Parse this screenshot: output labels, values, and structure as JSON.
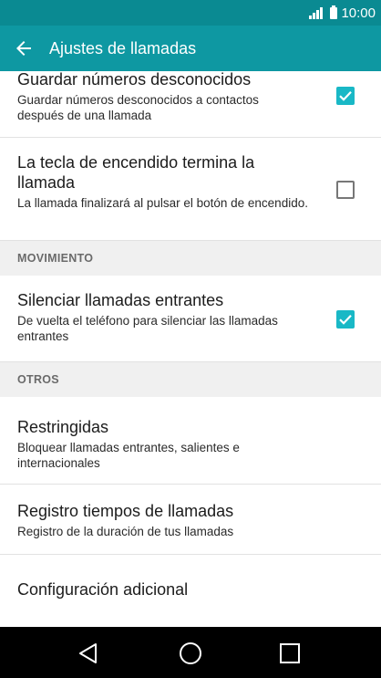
{
  "status_bar": {
    "time": "10:00",
    "icons": [
      "signal-icon",
      "battery-icon"
    ]
  },
  "app_bar": {
    "title": "Ajustes de llamadas",
    "back_icon": "back-arrow-icon"
  },
  "settings": {
    "items": [
      {
        "title": "Guardar números desconocidos",
        "subtitle": "Guardar números desconocidos a contactos después de una llamada",
        "checkbox": true
      },
      {
        "title": "La tecla de encendido termina la llamada",
        "subtitle": "La llamada finalizará al pulsar el botón de encendido.",
        "checkbox": false
      }
    ],
    "movimiento_header": "MOVIMIENTO",
    "movimiento_items": [
      {
        "title": "Silenciar llamadas entrantes",
        "subtitle": "De vuelta el teléfono para silenciar las llamadas entrantes",
        "checkbox": true
      }
    ],
    "otros_header": "OTROS",
    "otros_items": [
      {
        "title": "Restringidas",
        "subtitle": "Bloquear llamadas entrantes, salientes e internacionales"
      },
      {
        "title": "Registro tiempos de llamadas",
        "subtitle": "Registro de la duración de tus llamadas"
      },
      {
        "title": "Configuración adicional"
      }
    ]
  },
  "nav_bar": {
    "icons": [
      "back-triangle-icon",
      "home-circle-icon",
      "recents-square-icon"
    ]
  },
  "colors": {
    "status_bar": "#0a8a92",
    "app_bar": "#0e98a2",
    "checkbox_accent": "#19b8c6",
    "section_bg": "#f0f0f0"
  }
}
